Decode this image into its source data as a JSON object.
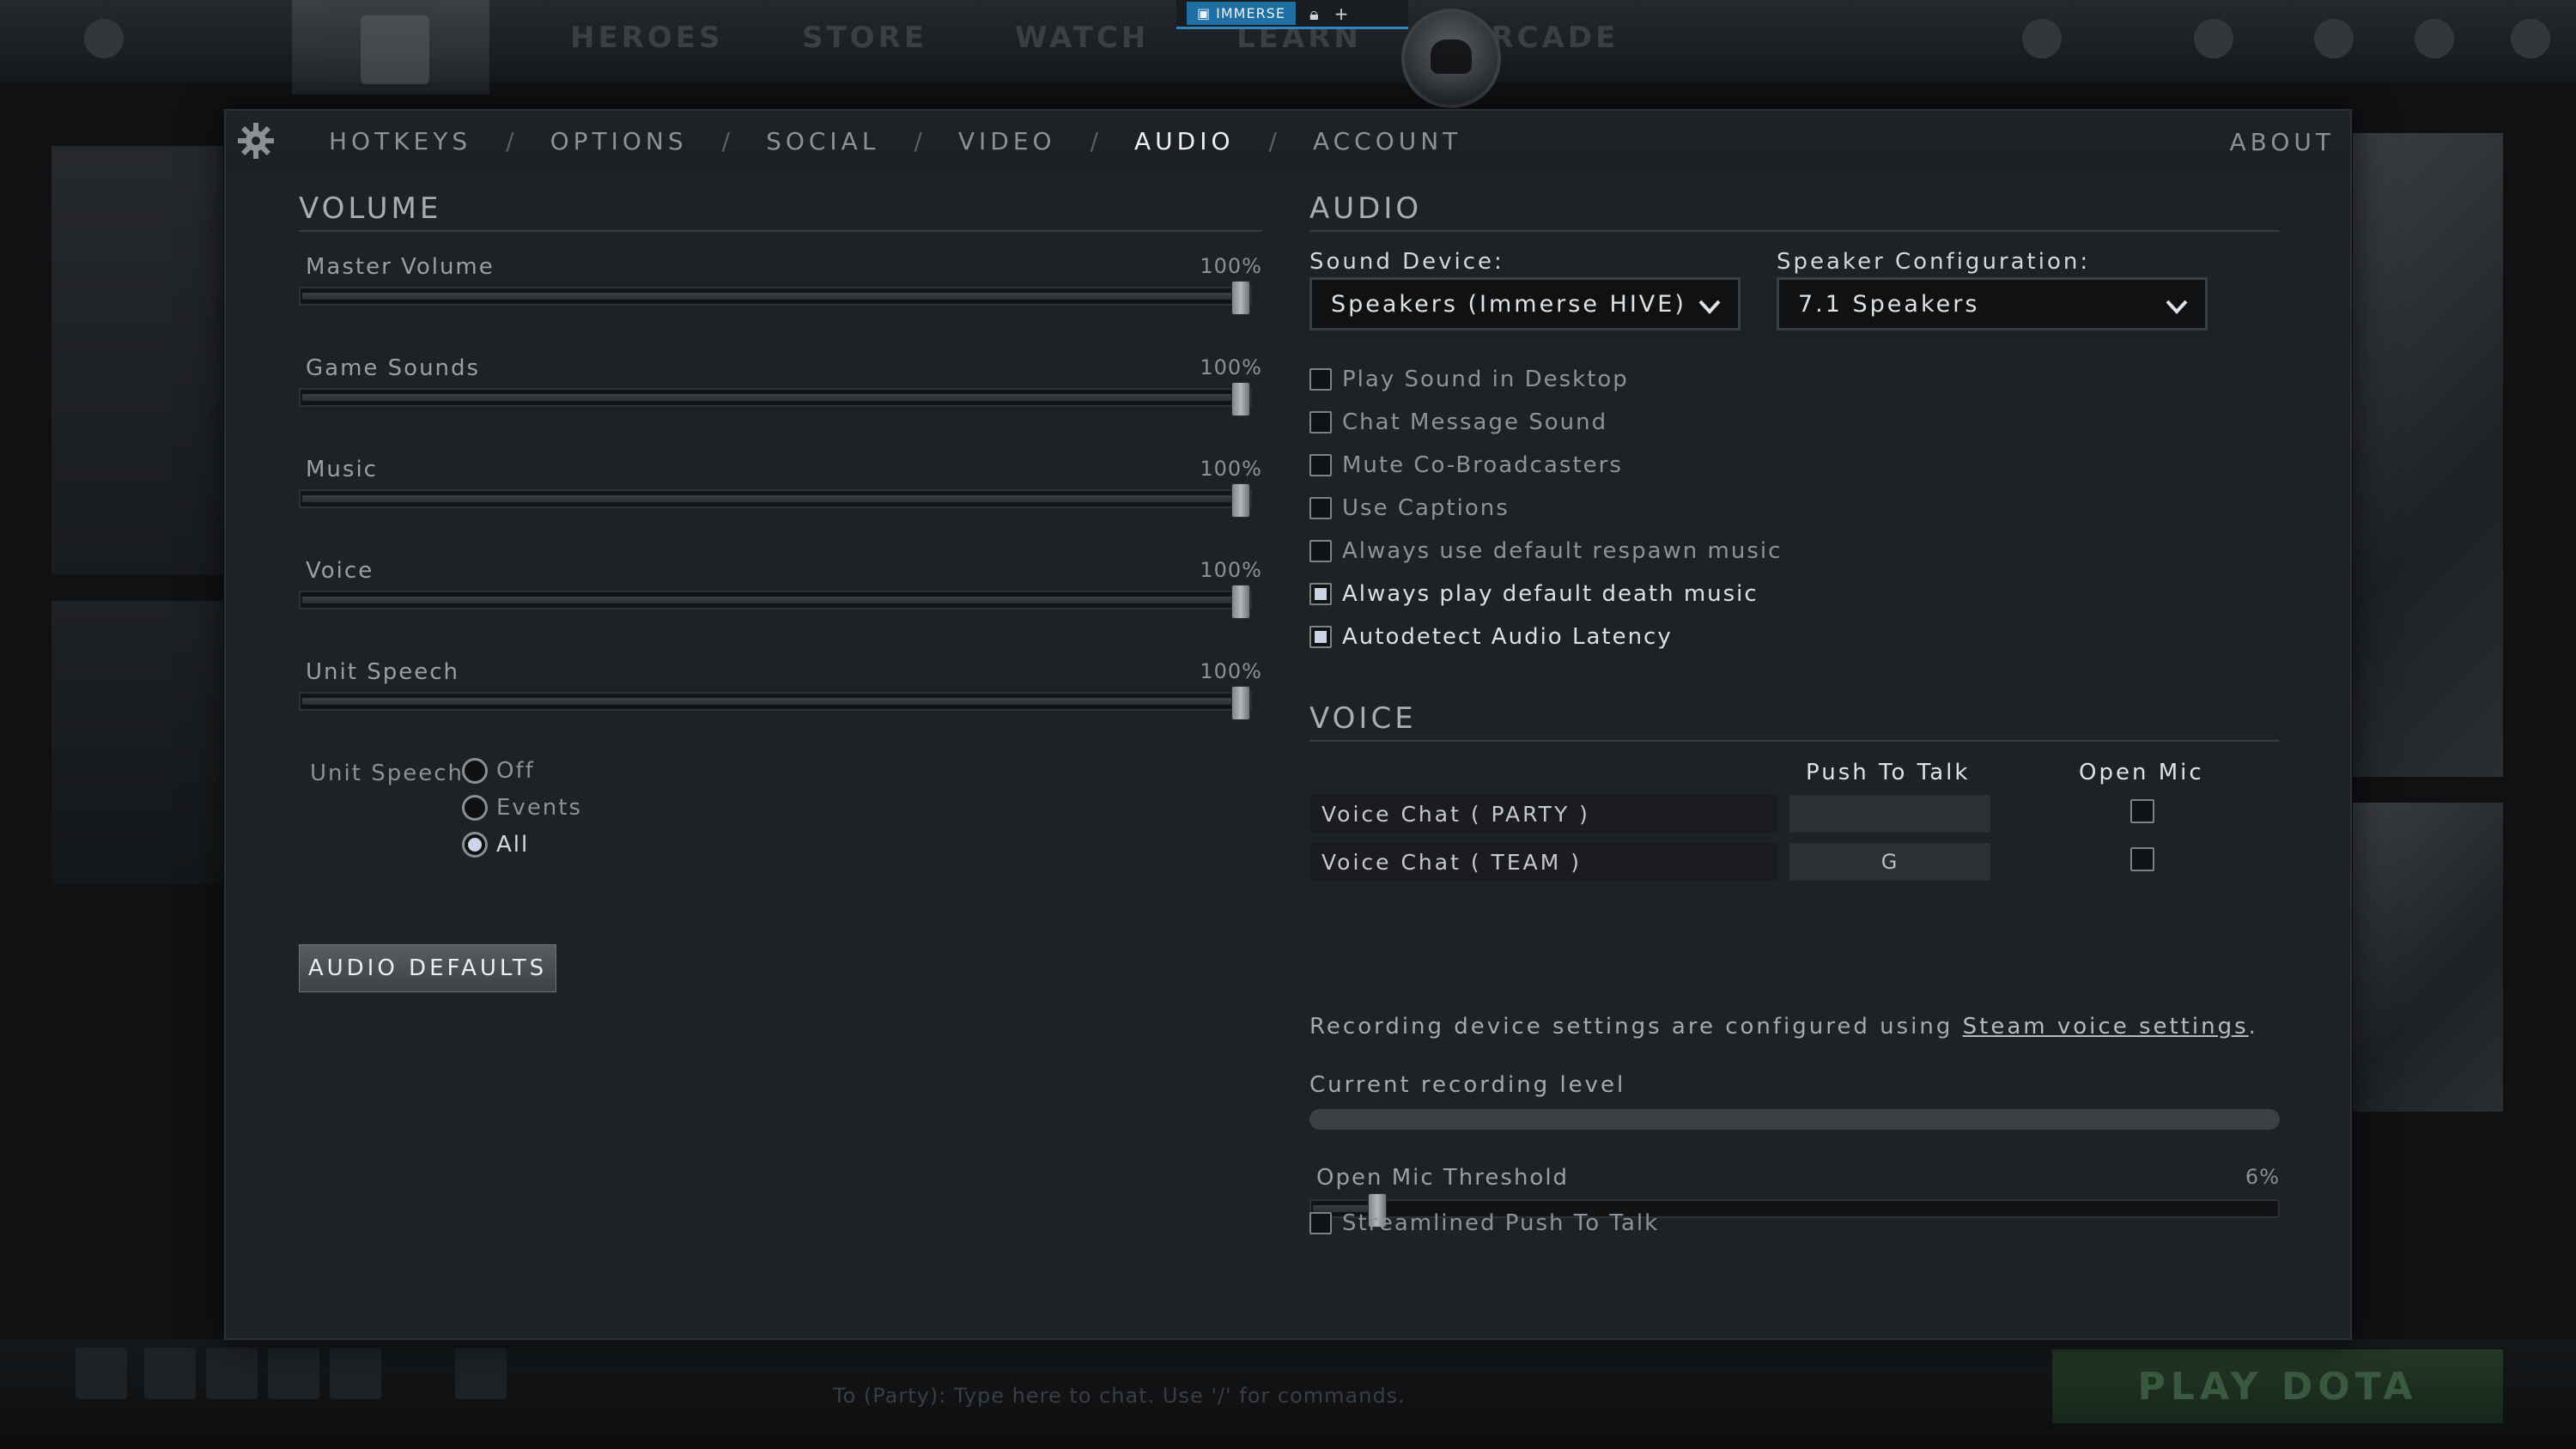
{
  "background": {
    "immerse_tab_label": "IMMERSE",
    "nav_items": [
      "HEROES",
      "STORE",
      "WATCH",
      "LEARN",
      "ARCADE"
    ],
    "play_button": "PLAY DOTA",
    "chat_hint": "To (Party): Type here to chat. Use '/' for commands."
  },
  "tabs": [
    {
      "label": "HOTKEYS"
    },
    {
      "label": "OPTIONS"
    },
    {
      "label": "SOCIAL"
    },
    {
      "label": "VIDEO"
    },
    {
      "label": "AUDIO",
      "active": true
    },
    {
      "label": "ACCOUNT"
    }
  ],
  "tab_separator": "/",
  "about_label": "ABOUT",
  "volume": {
    "title": "VOLUME",
    "sliders": [
      {
        "label": "Master Volume",
        "value_text": "100%",
        "value": 100
      },
      {
        "label": "Game Sounds",
        "value_text": "100%",
        "value": 100
      },
      {
        "label": "Music",
        "value_text": "100%",
        "value": 100
      },
      {
        "label": "Voice",
        "value_text": "100%",
        "value": 100
      },
      {
        "label": "Unit Speech",
        "value_text": "100%",
        "value": 100
      }
    ],
    "unit_speech": {
      "label": "Unit Speech",
      "options": [
        {
          "label": "Off",
          "selected": false
        },
        {
          "label": "Events",
          "selected": false
        },
        {
          "label": "All",
          "selected": true
        }
      ]
    },
    "defaults_button": "AUDIO DEFAULTS"
  },
  "audio": {
    "title": "AUDIO",
    "sound_device_label": "Sound Device:",
    "sound_device_value": "Speakers (Immerse HIVE)",
    "speaker_config_label": "Speaker Configuration:",
    "speaker_config_value": "7.1 Speakers",
    "checkboxes": [
      {
        "label": "Play Sound in Desktop",
        "checked": false
      },
      {
        "label": "Chat Message Sound",
        "checked": false
      },
      {
        "label": "Mute Co-Broadcasters",
        "checked": false
      },
      {
        "label": "Use Captions",
        "checked": false
      },
      {
        "label": "Always use default respawn music",
        "checked": false
      },
      {
        "label": "Always play default death music",
        "checked": true
      },
      {
        "label": "Autodetect Audio Latency",
        "checked": true
      }
    ]
  },
  "voice": {
    "title": "VOICE",
    "push_to_talk_header": "Push To Talk",
    "open_mic_header": "Open Mic",
    "channels": [
      {
        "name": "Voice Chat ( PARTY )",
        "key": "",
        "open_mic": false
      },
      {
        "name": "Voice Chat ( TEAM )",
        "key": "G",
        "open_mic": false
      }
    ],
    "note_text": "Recording device settings are configured using ",
    "note_link": "Steam voice settings",
    "note_end": ".",
    "recording_level_label": "Current recording level",
    "threshold_label": "Open Mic Threshold",
    "threshold_value_text": "6%",
    "threshold_value": 6,
    "streamlined_label": "Streamlined Push To Talk",
    "streamlined_checked": false
  }
}
